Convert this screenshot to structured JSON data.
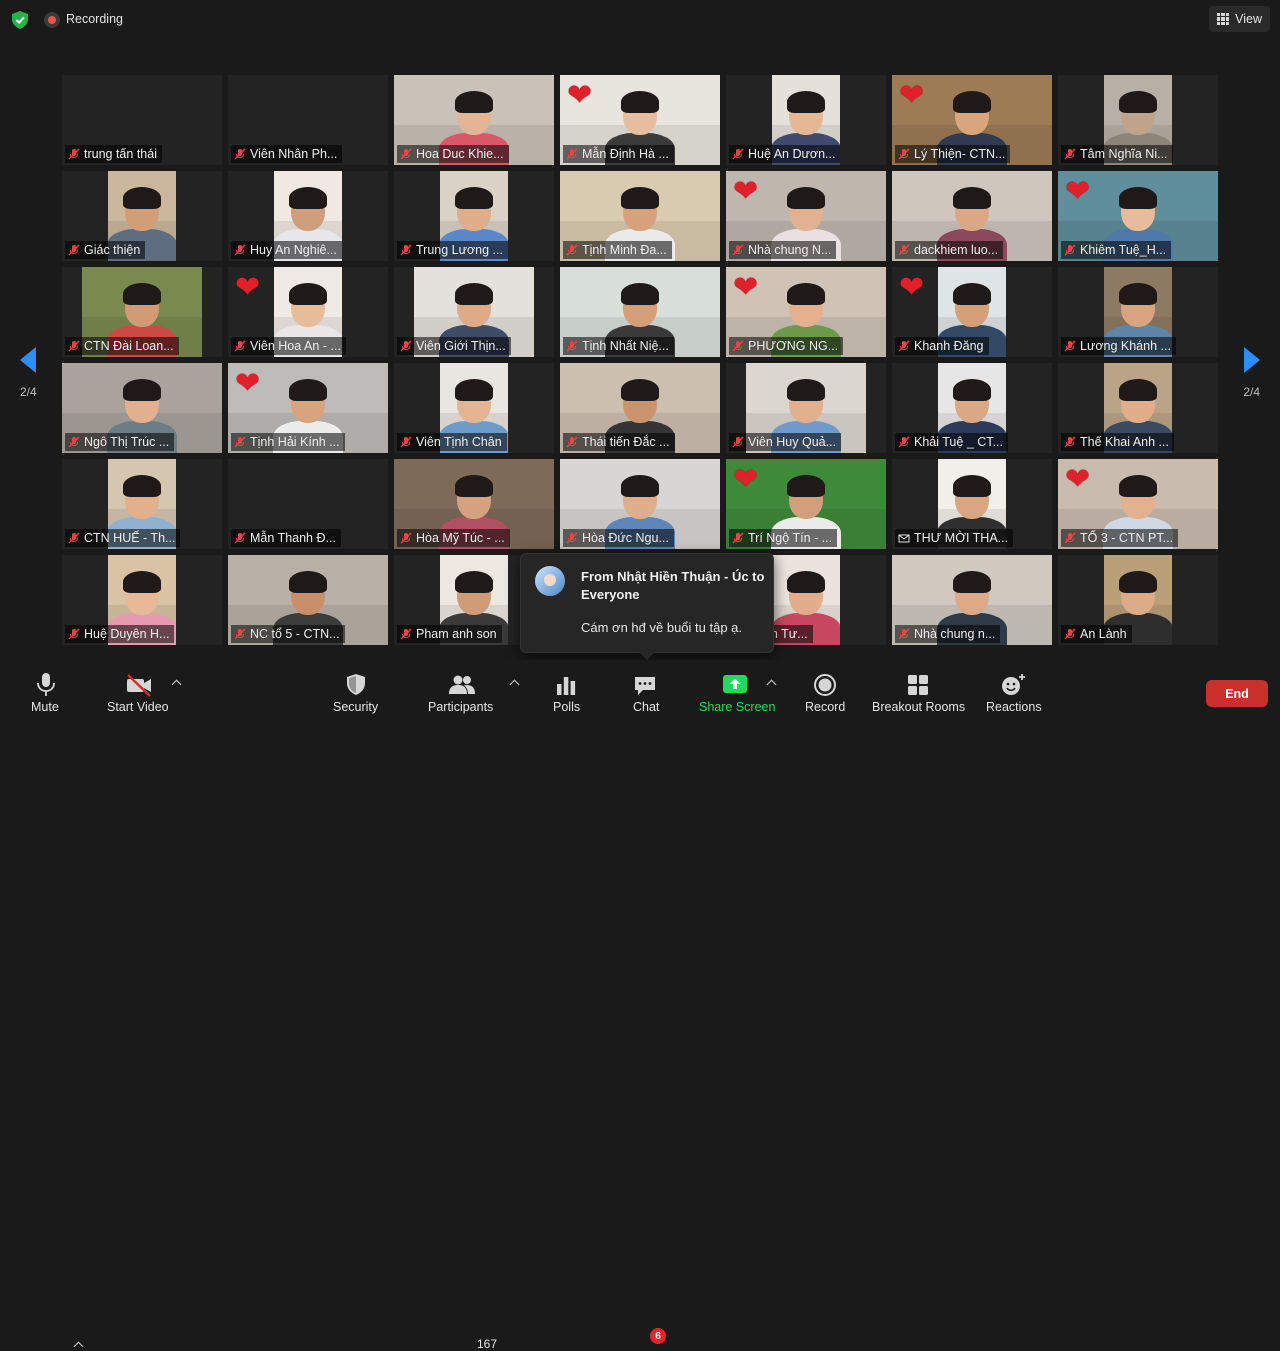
{
  "topbar": {
    "recording_label": "Recording",
    "view_label": "View"
  },
  "gallery": {
    "page_left": "2/4",
    "page_right": "2/4",
    "tiles": [
      {
        "name": "trung tấn thái",
        "video": false
      },
      {
        "name": "Viên Nhân Ph...",
        "video": false
      },
      {
        "name": "Hoa Duc Khie...",
        "video": true,
        "heart": false,
        "x": 0,
        "w": 160,
        "bg": "#c9c2b8",
        "skin": "#e3b596",
        "cloth": "#d8586a"
      },
      {
        "name": "Mẫn Định Hà ...",
        "video": true,
        "heart": true,
        "x": 0,
        "w": 160,
        "bg": "#e8e4de",
        "skin": "#e6bd9e",
        "cloth": "#3b3b3b"
      },
      {
        "name": "Huệ An Dươn...",
        "video": true,
        "heart": false,
        "x": 46,
        "w": 68,
        "bg": "#e5e0d8",
        "skin": "#e4b896",
        "cloth": "#3f4a6e"
      },
      {
        "name": "Lý Thiện- CTN...",
        "video": true,
        "heart": true,
        "x": 0,
        "w": 160,
        "bg": "#9c7b55",
        "skin": "#d9a57c",
        "cloth": "#2f3b52"
      },
      {
        "name": "Tâm Nghĩa Ni...",
        "video": true,
        "heart": false,
        "x": 46,
        "w": 68,
        "bg": "#b7b0a6",
        "skin": "#bfa48a",
        "cloth": "#8c8478"
      },
      {
        "name": "Giác thiện",
        "video": true,
        "heart": false,
        "x": 46,
        "w": 68,
        "bg": "#cbb89c",
        "skin": "#d19e78",
        "cloth": "#5f6d80"
      },
      {
        "name": "Huy An Nghiê...",
        "video": true,
        "heart": false,
        "x": 46,
        "w": 68,
        "bg": "#efe9e1",
        "skin": "#cf9f7d",
        "cloth": "#e7e7ea"
      },
      {
        "name": "Trung Lương ...",
        "video": true,
        "heart": false,
        "x": 46,
        "w": 68,
        "bg": "#d9d2c5",
        "skin": "#dfae8a",
        "cloth": "#5a88c9"
      },
      {
        "name": "Tịnh Minh Đa...",
        "video": true,
        "heart": false,
        "x": 0,
        "w": 160,
        "bg": "#d9cbb0",
        "skin": "#d6a17c",
        "cloth": "#eaeaea"
      },
      {
        "name": "Nhà chung N...",
        "video": true,
        "heart": true,
        "x": 0,
        "w": 160,
        "bg": "#bfb6ae",
        "skin": "#e0b192",
        "cloth": "#e9e1df"
      },
      {
        "name": "dackhiem luo...",
        "video": true,
        "heart": false,
        "x": 0,
        "w": 160,
        "bg": "#cfc6bd",
        "skin": "#dba887",
        "cloth": "#8a4a5c"
      },
      {
        "name": "Khiêm Tuệ_H...",
        "video": true,
        "heart": true,
        "x": 0,
        "w": 160,
        "bg": "#5f8e9c",
        "skin": "#e6bc9c",
        "cloth": "#4f79a8"
      },
      {
        "name": "CTN Đài Loan...",
        "video": true,
        "heart": false,
        "x": 20,
        "w": 120,
        "bg": "#7a8a4e",
        "skin": "#d19c75",
        "cloth": "#cc4a45"
      },
      {
        "name": "Viên Hoa An - ...",
        "video": true,
        "heart": true,
        "x": 46,
        "w": 68,
        "bg": "#efeae5",
        "skin": "#e7bc9b",
        "cloth": "#e8e6e6"
      },
      {
        "name": "Viên Giới Thịn...",
        "video": true,
        "heart": false,
        "x": 20,
        "w": 120,
        "bg": "#e4e1dd",
        "skin": "#dfaa87",
        "cloth": "#3e4c66"
      },
      {
        "name": "Tịnh Nhất Niệ...",
        "video": true,
        "heart": false,
        "x": 0,
        "w": 160,
        "bg": "#d8dfdb",
        "skin": "#d39e78",
        "cloth": "#3a3a3a"
      },
      {
        "name": "PHƯƠNG NG...",
        "video": true,
        "heart": true,
        "x": 0,
        "w": 160,
        "bg": "#cfc3b6",
        "skin": "#e3b18f",
        "cloth": "#6a9a4a"
      },
      {
        "name": "Khanh Đăng",
        "video": true,
        "heart": true,
        "x": 46,
        "w": 68,
        "bg": "#dfe5e6",
        "skin": "#d3a07c",
        "cloth": "#324a66"
      },
      {
        "name": "Lương Khánh ...",
        "video": true,
        "heart": false,
        "x": 46,
        "w": 68,
        "bg": "#8c7a62",
        "skin": "#d7a581",
        "cloth": "#5e84a8"
      },
      {
        "name": "Ngô Thị Trúc ...",
        "video": true,
        "heart": false,
        "x": 0,
        "w": 160,
        "bg": "#a9a39c",
        "skin": "#e0b090",
        "cloth": "#6c7d86"
      },
      {
        "name": "Tịnh Hải Kính ...",
        "video": true,
        "heart": true,
        "x": 0,
        "w": 160,
        "bg": "#bdbcb8",
        "skin": "#d8a37e",
        "cloth": "#ececec"
      },
      {
        "name": "Viên Tịnh Chân",
        "video": true,
        "heart": false,
        "x": 46,
        "w": 68,
        "bg": "#e9e5e0",
        "skin": "#e4b594",
        "cloth": "#6d9cc9"
      },
      {
        "name": "Thái tiến Đắc ...",
        "video": true,
        "heart": false,
        "x": 0,
        "w": 160,
        "bg": "#cbbfb0",
        "skin": "#c9936d",
        "cloth": "#353535"
      },
      {
        "name": "Viên Huy Quả...",
        "video": true,
        "heart": false,
        "x": 20,
        "w": 120,
        "bg": "#dcd6d0",
        "skin": "#e1b08e",
        "cloth": "#6f9ac9"
      },
      {
        "name": "Khải Tuệ _ CT...",
        "video": true,
        "heart": false,
        "x": 46,
        "w": 68,
        "bg": "#e6e6e6",
        "skin": "#d9a885",
        "cloth": "#2b3b5a"
      },
      {
        "name": "Thế Khai Anh ...",
        "video": true,
        "heart": false,
        "x": 46,
        "w": 68,
        "bg": "#b9a488",
        "skin": "#e0ae8c",
        "cloth": "#3a4a60"
      },
      {
        "name": "CTN HUẾ - Th...",
        "video": true,
        "heart": false,
        "x": 46,
        "w": 68,
        "bg": "#d5c6b0",
        "skin": "#e1b08f",
        "cloth": "#8fb1cf"
      },
      {
        "name": "Mẫn Thanh Đ...",
        "video": false
      },
      {
        "name": "Hòa Mỹ Túc - ...",
        "video": true,
        "heart": false,
        "x": 0,
        "w": 160,
        "bg": "#7d6a58",
        "skin": "#d4a27f",
        "cloth": "#b05060"
      },
      {
        "name": "Hòa Đức Ngu...",
        "video": true,
        "heart": false,
        "x": 0,
        "w": 160,
        "bg": "#d8d6d4",
        "skin": "#dfae8c",
        "cloth": "#5f86b8"
      },
      {
        "name": "Trí Ngộ Tín - ...",
        "video": true,
        "heart": true,
        "x": 0,
        "w": 160,
        "bg": "#3f8a3a",
        "skin": "#d29f7c",
        "cloth": "#ececec"
      },
      {
        "name": "THƯ MỜI THA...",
        "video": true,
        "heart": false,
        "x": 46,
        "w": 68,
        "bg": "#f1efe9",
        "skin": "#d8a683",
        "cloth": "#2f2f2f",
        "icon": "letter"
      },
      {
        "name": "TỔ 3 - CTN PT...",
        "video": true,
        "heart": true,
        "x": 0,
        "w": 160,
        "bg": "#c9bcaf",
        "skin": "#e2b190",
        "cloth": "#cfd9e5"
      },
      {
        "name": "Huệ Duyên H...",
        "video": true,
        "heart": false,
        "x": 46,
        "w": 68,
        "bg": "#d8c4a4",
        "skin": "#e6b999",
        "cloth": "#e59ab0"
      },
      {
        "name": "NC tổ 5 - CTN...",
        "video": true,
        "heart": false,
        "x": 0,
        "w": 160,
        "bg": "#b9b1a7",
        "skin": "#c98f6b",
        "cloth": "#3c3c3c"
      },
      {
        "name": "Pham anh son",
        "video": true,
        "heart": false,
        "x": 46,
        "w": 68,
        "bg": "#ece7e1",
        "skin": "#d09c78",
        "cloth": "#3a3a3a"
      },
      {
        "name": "",
        "video": false,
        "hidden": true
      },
      {
        "name": "Nhân Tư...",
        "video": true,
        "heart": false,
        "x": 46,
        "w": 68,
        "bg": "#ebe4dc",
        "skin": "#e1ad8c",
        "cloth": "#c54860"
      },
      {
        "name": "Nhà chung n...",
        "video": true,
        "heart": false,
        "x": 0,
        "w": 160,
        "bg": "#cfc9bf",
        "skin": "#dcaa88",
        "cloth": "#2f3a48"
      },
      {
        "name": "An Lành",
        "video": true,
        "heart": false,
        "x": 46,
        "w": 68,
        "bg": "#b9a078",
        "skin": "#dcab88",
        "cloth": "#2e2e2e"
      }
    ]
  },
  "chat_popup": {
    "from": "From Nhật Hiền Thuận - Úc to Everyone",
    "message": "Cám ơn hđ về buổi tu tập ạ."
  },
  "toolbar": {
    "mute": "Mute",
    "start_video": "Start Video",
    "security": "Security",
    "participants": "Participants",
    "participants_count": "167",
    "polls": "Polls",
    "chat": "Chat",
    "chat_badge": "6",
    "share_screen": "Share Screen",
    "record": "Record",
    "breakout_rooms": "Breakout Rooms",
    "reactions": "Reactions",
    "end": "End"
  },
  "colors": {
    "accent": "#2d8cff",
    "share_green": "#23d959",
    "end_red": "#c8302c",
    "heart_red": "#e0202a"
  }
}
